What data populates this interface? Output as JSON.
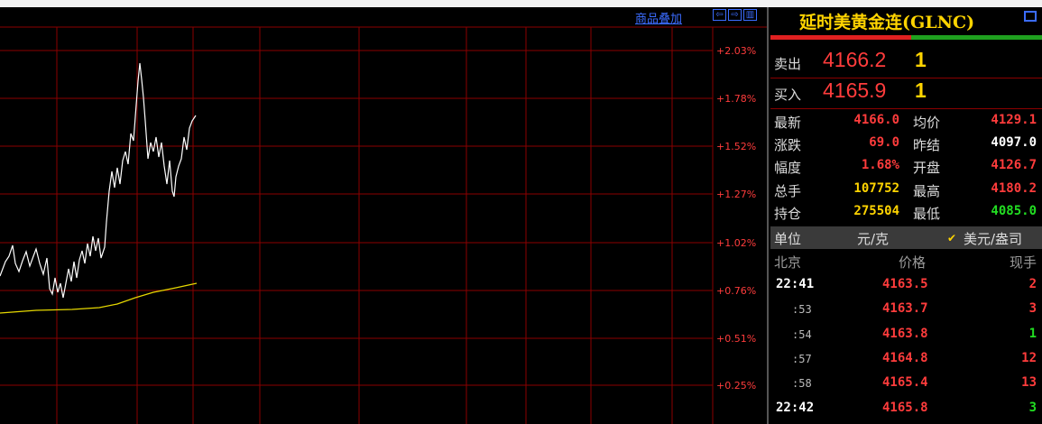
{
  "chart": {
    "overlay_link": "商品叠加",
    "window_buttons": [
      "⇦",
      "⇨",
      "▥"
    ],
    "pct_labels": [
      "+2.03%",
      "+1.78%",
      "+1.52%",
      "+1.27%",
      "+1.02%",
      "+0.76%",
      "+0.51%",
      "+0.25%"
    ],
    "colors": {
      "grid": "#8b0000",
      "price_line": "#ffffff",
      "avg_line": "#e6d800",
      "pct_text": "#ff3c3c"
    }
  },
  "panel": {
    "title": "延时美黄金连(GLNC)",
    "sell": {
      "label": "卖出",
      "price": "4166.2",
      "volume": "1"
    },
    "buy": {
      "label": "买入",
      "price": "4165.9",
      "volume": "1"
    },
    "stats": [
      {
        "l1": "最新",
        "v1": "4166.0",
        "c1": "#ff3c3c",
        "l2": "均价",
        "v2": "4129.1",
        "c2": "#ff3c3c"
      },
      {
        "l1": "涨跌",
        "v1": "69.0",
        "c1": "#ff3c3c",
        "l2": "昨结",
        "v2": "4097.0",
        "c2": "#ffffff"
      },
      {
        "l1": "幅度",
        "v1": "1.68%",
        "c1": "#ff3c3c",
        "l2": "开盘",
        "v2": "4126.7",
        "c2": "#ff3c3c"
      },
      {
        "l1": "总手",
        "v1": "107752",
        "c1": "#ffd400",
        "l2": "最高",
        "v2": "4180.2",
        "c2": "#ff3c3c"
      },
      {
        "l1": "持仓",
        "v1": "275504",
        "c1": "#ffd400",
        "l2": "最低",
        "v2": "4085.0",
        "c2": "#22dd22"
      }
    ],
    "unit": {
      "label": "单位",
      "unit1": "元/克",
      "unit2": "美元/盎司",
      "check": "✔"
    },
    "ticks_header": {
      "time": "北京",
      "price": "价格",
      "vol": "现手"
    },
    "ticks": [
      {
        "time": "22:41",
        "price": "4163.5",
        "vol": "2",
        "vol_color": "#ff3c3c"
      },
      {
        "time": ":53",
        "price": "4163.7",
        "vol": "3",
        "vol_color": "#ff3c3c"
      },
      {
        "time": ":54",
        "price": "4163.8",
        "vol": "1",
        "vol_color": "#22dd22"
      },
      {
        "time": ":57",
        "price": "4164.8",
        "vol": "12",
        "vol_color": "#ff3c3c"
      },
      {
        "time": ":58",
        "price": "4165.4",
        "vol": "13",
        "vol_color": "#ff3c3c"
      },
      {
        "time": "22:42",
        "price": "4165.8",
        "vol": "3",
        "vol_color": "#22dd22"
      }
    ]
  }
}
